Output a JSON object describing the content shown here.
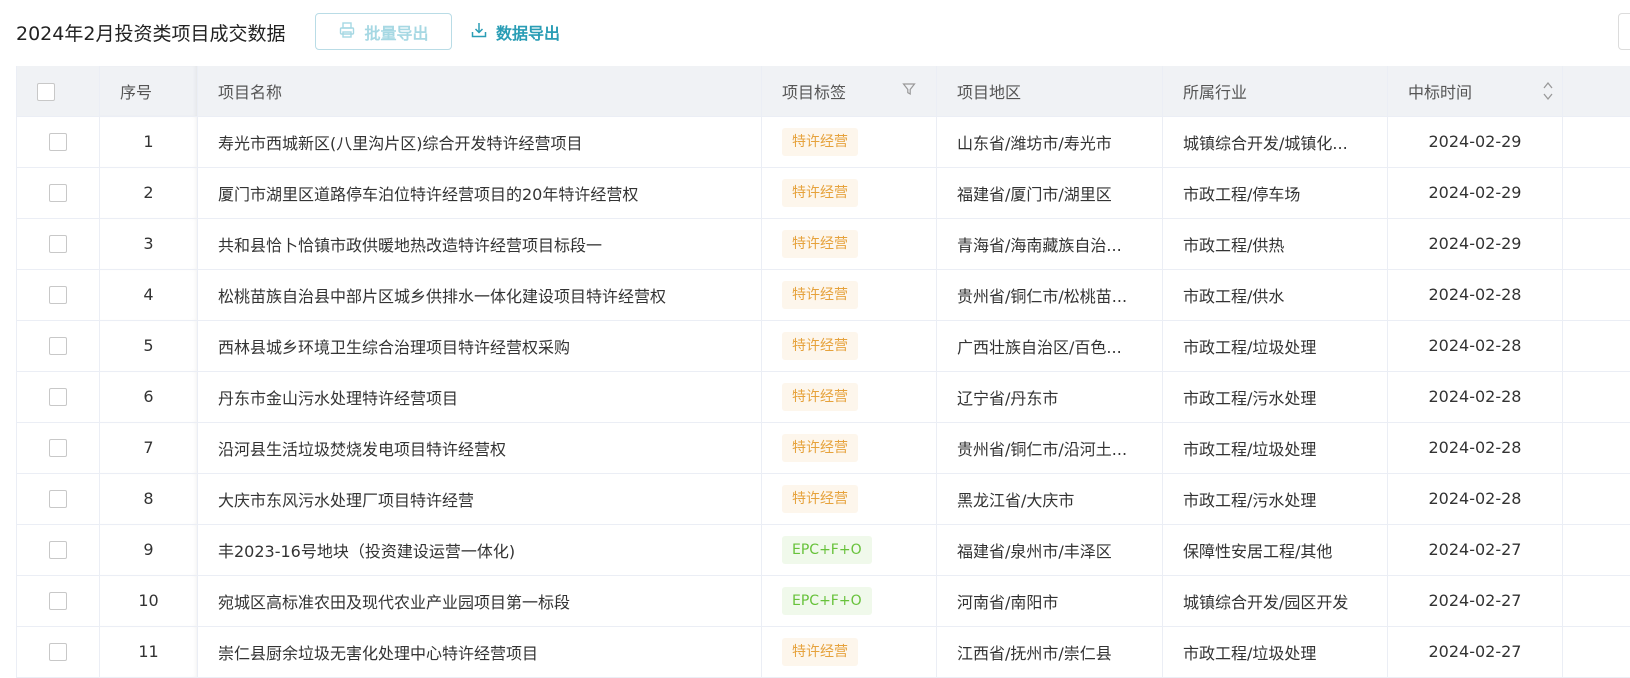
{
  "toolbar": {
    "title": "2024年2月投资类项目成交数据",
    "batch_export_label": "批量导出",
    "data_export_label": "数据导出"
  },
  "table": {
    "headers": {
      "seq": "序号",
      "name": "项目名称",
      "tag": "项目标签",
      "region": "项目地区",
      "industry": "所属行业",
      "time": "中标时间"
    },
    "rows": [
      {
        "seq": "1",
        "name": "寿光市西城新区(八里沟片区)综合开发特许经营项目",
        "tag": "特许经营",
        "tag_color": "yellow",
        "region": "山东省/潍坊市/寿光市",
        "industry": "城镇综合开发/城镇化...",
        "time": "2024-02-29"
      },
      {
        "seq": "2",
        "name": "厦门市湖里区道路停车泊位特许经营项目的20年特许经营权",
        "tag": "特许经营",
        "tag_color": "yellow",
        "region": "福建省/厦门市/湖里区",
        "industry": "市政工程/停车场",
        "time": "2024-02-29"
      },
      {
        "seq": "3",
        "name": "共和县恰卜恰镇市政供暖地热改造特许经营项目标段一",
        "tag": "特许经营",
        "tag_color": "yellow",
        "region": "青海省/海南藏族自治...",
        "industry": "市政工程/供热",
        "time": "2024-02-29"
      },
      {
        "seq": "4",
        "name": "松桃苗族自治县中部片区城乡供排水一体化建设项目特许经营权",
        "tag": "特许经营",
        "tag_color": "yellow",
        "region": "贵州省/铜仁市/松桃苗...",
        "industry": "市政工程/供水",
        "time": "2024-02-28"
      },
      {
        "seq": "5",
        "name": "西林县城乡环境卫生综合治理项目特许经营权采购",
        "tag": "特许经营",
        "tag_color": "yellow",
        "region": "广西壮族自治区/百色...",
        "industry": "市政工程/垃圾处理",
        "time": "2024-02-28"
      },
      {
        "seq": "6",
        "name": "丹东市金山污水处理特许经营项目",
        "tag": "特许经营",
        "tag_color": "yellow",
        "region": "辽宁省/丹东市",
        "industry": "市政工程/污水处理",
        "time": "2024-02-28"
      },
      {
        "seq": "7",
        "name": "沿河县生活垃圾焚烧发电项目特许经营权",
        "tag": "特许经营",
        "tag_color": "yellow",
        "region": "贵州省/铜仁市/沿河土...",
        "industry": "市政工程/垃圾处理",
        "time": "2024-02-28"
      },
      {
        "seq": "8",
        "name": "大庆市东风污水处理厂项目特许经营",
        "tag": "特许经营",
        "tag_color": "yellow",
        "region": "黑龙江省/大庆市",
        "industry": "市政工程/污水处理",
        "time": "2024-02-28"
      },
      {
        "seq": "9",
        "name": "丰2023-16号地块（投资建设运营一体化)",
        "tag": "EPC+F+O",
        "tag_color": "green",
        "region": "福建省/泉州市/丰泽区",
        "industry": "保障性安居工程/其他",
        "time": "2024-02-27"
      },
      {
        "seq": "10",
        "name": "宛城区高标准农田及现代农业产业园项目第一标段",
        "tag": "EPC+F+O",
        "tag_color": "green",
        "region": "河南省/南阳市",
        "industry": "城镇综合开发/园区开发",
        "time": "2024-02-27"
      },
      {
        "seq": "11",
        "name": "崇仁县厨余垃圾无害化处理中心特许经营项目",
        "tag": "特许经营",
        "tag_color": "yellow",
        "region": "江西省/抚州市/崇仁县",
        "industry": "市政工程/垃圾处理",
        "time": "2024-02-27"
      }
    ]
  },
  "icons": {
    "batch_export": "printer-icon",
    "data_export": "download-icon",
    "tag_filter": "filter-icon",
    "time_sort": "sort-icon"
  },
  "colors": {
    "accent": "#2a9db5",
    "tag_yellow_bg": "#fdf6ec",
    "tag_yellow_text": "#e6a23c",
    "tag_green_bg": "#f0f9eb",
    "tag_green_text": "#67c23a",
    "header_bg": "#f0f2f5"
  }
}
